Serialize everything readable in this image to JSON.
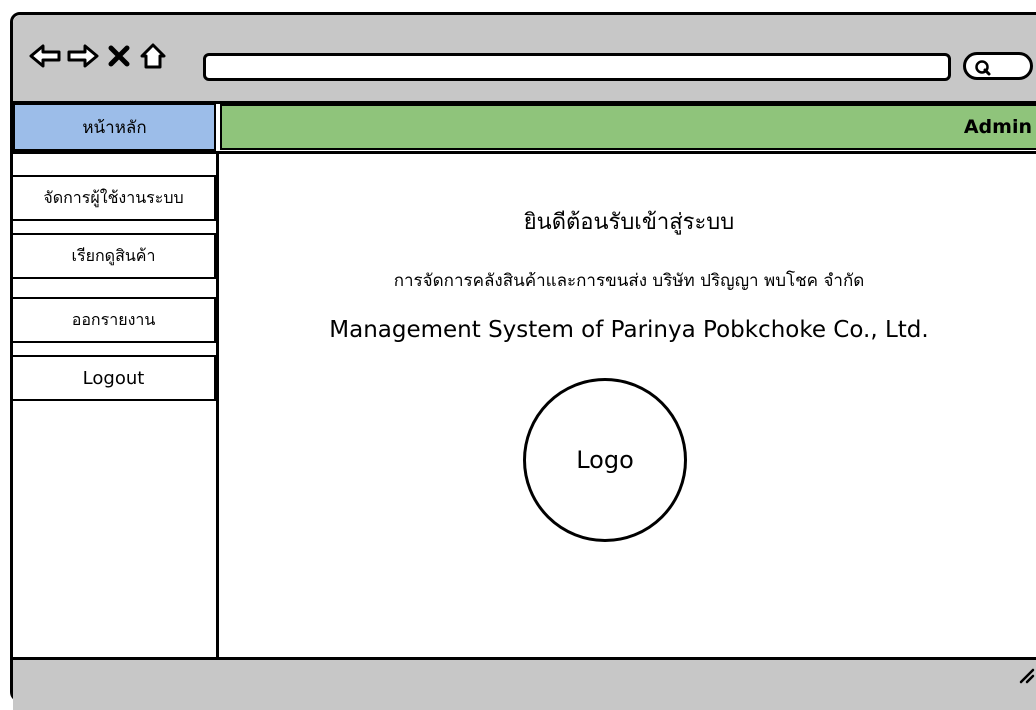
{
  "browser": {
    "nav_icons": [
      "back-arrow-icon",
      "forward-arrow-icon",
      "close-icon",
      "home-icon"
    ],
    "search_icon": "search-icon"
  },
  "header": {
    "home_tab": "หน้าหลัก",
    "user_label": "Admin",
    "home_color": "#9cbde9",
    "bar_color": "#8fc47b"
  },
  "sidebar": {
    "items": [
      {
        "label": "จัดการผู้ใช้งานระบบ"
      },
      {
        "label": "เรียกดูสินค้า"
      },
      {
        "label": "ออกรายงาน"
      },
      {
        "label": "Logout"
      }
    ]
  },
  "main": {
    "welcome": "ยินดีต้อนรับเข้าสู่ระบบ",
    "subtitle_th": "การจัดการคลังสินค้าและการขนส่ง บริษัท ปริญญา พบโชค จำกัด",
    "subtitle_en": "Management System of Parinya Pobkchoke Co., Ltd.",
    "logo_text": "Logo"
  }
}
